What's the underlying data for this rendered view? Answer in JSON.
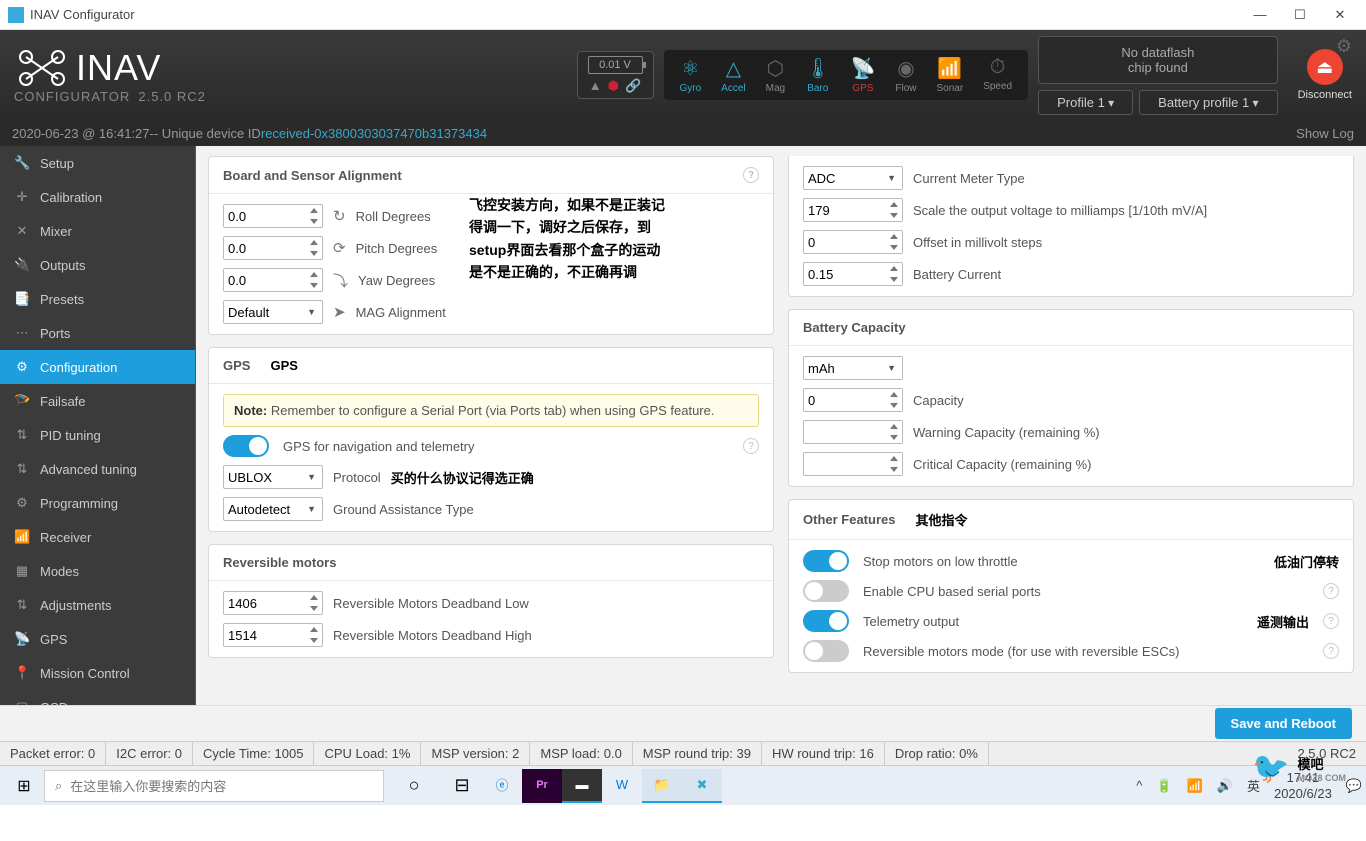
{
  "window": {
    "title": "INAV Configurator"
  },
  "logo": {
    "brand": "INAV",
    "sub": "CONFIGURATOR",
    "version": "2.5.0 RC2"
  },
  "header": {
    "battery_v": "0.01 V",
    "sensors": [
      {
        "label": "Gyro",
        "active": true
      },
      {
        "label": "Accel",
        "active": true
      },
      {
        "label": "Mag",
        "active": false
      },
      {
        "label": "Baro",
        "active": true
      },
      {
        "label": "GPS",
        "active": false,
        "red": true
      },
      {
        "label": "Flow",
        "active": false
      },
      {
        "label": "Sonar",
        "active": false
      },
      {
        "label": "Speed",
        "active": false
      }
    ],
    "dataflash_l1": "No dataflash",
    "dataflash_l2": "chip found",
    "profile": "Profile 1",
    "battery_profile": "Battery profile 1",
    "disconnect": "Disconnect",
    "show_log": "Show Log"
  },
  "log": {
    "ts": "2020-06-23 @ 16:41:27",
    "sep": " -- Unique device ID ",
    "received": "received",
    "dash": " - ",
    "hex": "0x3800303037470b31373434"
  },
  "nav": {
    "items": [
      {
        "icon": "🔧",
        "label": "Setup"
      },
      {
        "icon": "✛",
        "label": "Calibration"
      },
      {
        "icon": "✕",
        "label": "Mixer"
      },
      {
        "icon": "🔌",
        "label": "Outputs"
      },
      {
        "icon": "📑",
        "label": "Presets"
      },
      {
        "icon": "⋯",
        "label": "Ports"
      },
      {
        "icon": "⚙",
        "label": "Configuration",
        "active": true
      },
      {
        "icon": "🪂",
        "label": "Failsafe"
      },
      {
        "icon": "⇅",
        "label": "PID tuning"
      },
      {
        "icon": "⇅",
        "label": "Advanced tuning"
      },
      {
        "icon": "⚙",
        "label": "Programming"
      },
      {
        "icon": "📶",
        "label": "Receiver"
      },
      {
        "icon": "▦",
        "label": "Modes"
      },
      {
        "icon": "⇅",
        "label": "Adjustments"
      },
      {
        "icon": "📡",
        "label": "GPS"
      },
      {
        "icon": "📍",
        "label": "Mission Control"
      },
      {
        "icon": "▢",
        "label": "OSD"
      }
    ]
  },
  "left_panels": {
    "alignment": {
      "title": "Board and Sensor Alignment",
      "roll": {
        "val": "0.0",
        "label": "Roll Degrees"
      },
      "pitch": {
        "val": "0.0",
        "label": "Pitch Degrees"
      },
      "yaw": {
        "val": "0.0",
        "label": "Yaw Degrees"
      },
      "mag": {
        "val": "Default",
        "label": "MAG Alignment"
      },
      "note": "飞控安装方向，如果不是正装记得调一下，调好之后保存，到setup界面去看那个盒子的运动是不是正确的，不正确再调"
    },
    "gps": {
      "title": "GPS",
      "heading_cn": "GPS",
      "note_label": "Note:",
      "note_text": " Remember to configure a Serial Port (via Ports tab) when using GPS feature.",
      "toggle_label": "GPS for navigation and telemetry",
      "protocol": {
        "val": "UBLOX",
        "label": "Protocol",
        "cn": "买的什么协议记得选正确"
      },
      "ground": {
        "val": "Autodetect",
        "label": "Ground Assistance Type"
      }
    },
    "rev": {
      "title": "Reversible motors",
      "low": {
        "val": "1406",
        "label": "Reversible Motors Deadband Low"
      },
      "high": {
        "val": "1514",
        "label": "Reversible Motors Deadband High"
      }
    }
  },
  "right_panels": {
    "current": {
      "type": {
        "val": "ADC",
        "label": "Current Meter Type"
      },
      "scale": {
        "val": "179",
        "label": "Scale the output voltage to milliamps [1/10th mV/A]"
      },
      "offset": {
        "val": "0",
        "label": "Offset in millivolt steps"
      },
      "bcur": {
        "val": "0.15",
        "label": "Battery Current"
      }
    },
    "capacity": {
      "title": "Battery Capacity",
      "unit": "mAh",
      "cap": {
        "val": "0",
        "label": "Capacity"
      },
      "warn": {
        "val": "",
        "label": "Warning Capacity (remaining %)"
      },
      "crit": {
        "val": "",
        "label": "Critical Capacity (remaining %)"
      }
    },
    "other": {
      "title": "Other Features",
      "cn": "其他指令",
      "f1": {
        "label": "Stop motors on low throttle",
        "cn": "低油门停转",
        "on": true
      },
      "f2": {
        "label": "Enable CPU based serial ports",
        "on": false,
        "help": true
      },
      "f3": {
        "label": "Telemetry output",
        "cn": "遥测输出",
        "on": true,
        "help": true
      },
      "f4": {
        "label": "Reversible motors mode (for use with reversible ESCs)",
        "on": false,
        "help": true
      }
    }
  },
  "save_btn": "Save and Reboot",
  "status": {
    "cells": [
      "Packet error: 0",
      "I2C error: 0",
      "Cycle Time: 1005",
      "CPU Load: 1%",
      "MSP version: 2",
      "MSP load: 0.0",
      "MSP round trip: 39",
      "HW round trip: 16",
      "Drop ratio: 0%"
    ],
    "version": "2.5.0 RC2"
  },
  "taskbar": {
    "search_placeholder": "在这里输入你要搜索的内容",
    "ime": "英",
    "time": "17:41",
    "date": "2020/6/23"
  },
  "watermark": {
    "text": "模吧",
    "sub": "MOZ8 COM"
  }
}
